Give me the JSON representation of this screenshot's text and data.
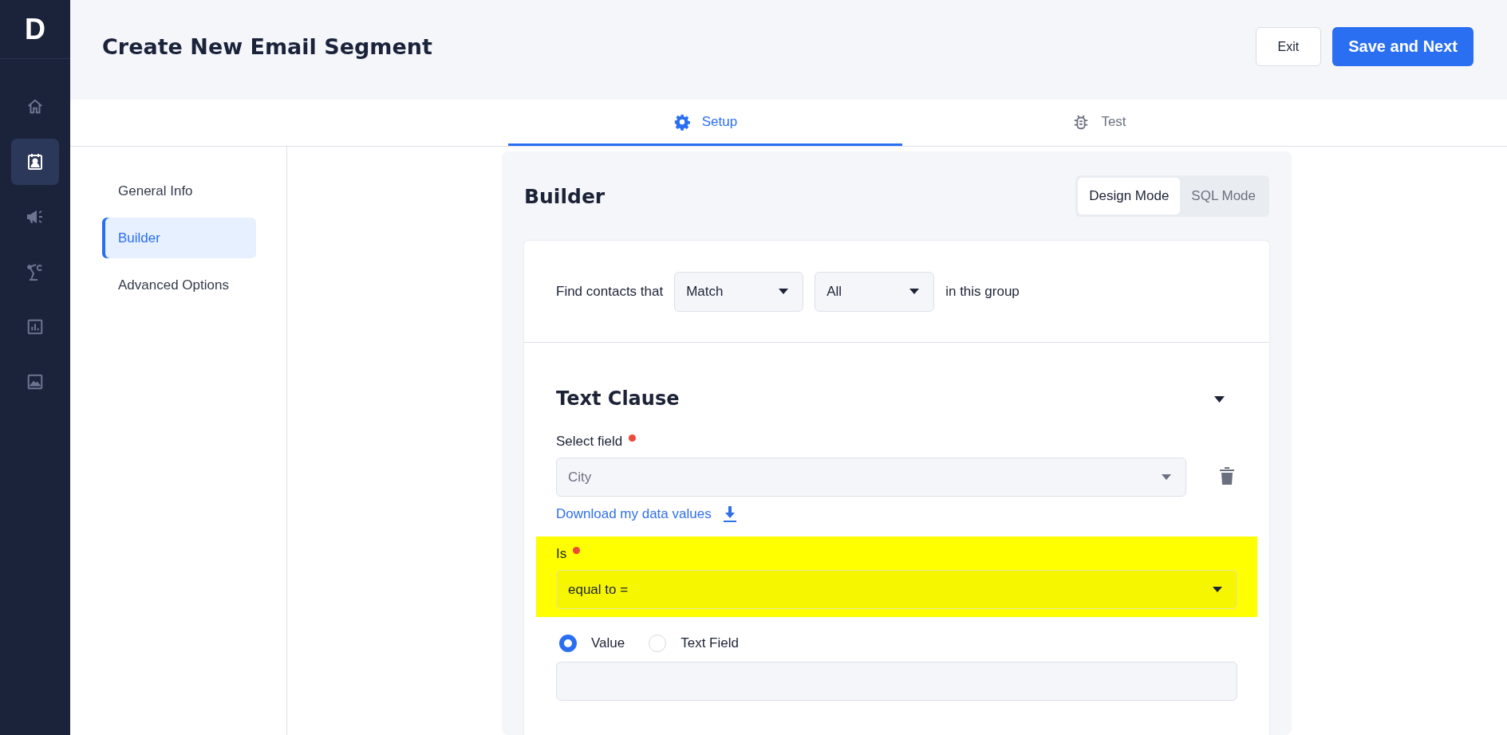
{
  "logo": "D",
  "rail": [
    {
      "kind": "home",
      "selected": false
    },
    {
      "kind": "contacts",
      "selected": true
    },
    {
      "kind": "campaigns",
      "selected": false
    },
    {
      "kind": "automation",
      "selected": false
    },
    {
      "kind": "reports",
      "selected": false
    },
    {
      "kind": "media",
      "selected": false
    }
  ],
  "header": {
    "title": "Create New Email Segment",
    "buttons": [
      {
        "label": "Exit",
        "kind": "secondary"
      },
      {
        "label": "Save and Next",
        "kind": "primary"
      }
    ]
  },
  "tabs": [
    {
      "label": "Setup",
      "kind": "setup",
      "selected": true
    },
    {
      "label": "Test",
      "kind": "test",
      "selected": false
    }
  ],
  "steps": [
    {
      "label": "General Info",
      "selected": false
    },
    {
      "label": "Builder",
      "selected": true
    },
    {
      "label": "Advanced Options",
      "selected": false
    }
  ],
  "builder": {
    "title": "Builder",
    "modes": [
      {
        "label": "Design Mode",
        "selected": true
      },
      {
        "label": "SQL Mode",
        "selected": false
      }
    ],
    "match_row": {
      "prefix": "Find contacts that",
      "match": "Match",
      "scope": "All",
      "suffix": "in this group"
    },
    "clause": {
      "title": "Text Clause",
      "expanded": true,
      "field": {
        "label": "Select field",
        "required": true,
        "value": "City"
      },
      "download_link": "Download my data values",
      "operator": {
        "label": "Is",
        "required": true,
        "value": "equal to =",
        "highlighted": true
      },
      "value_types": [
        {
          "label": "Value",
          "selected": true
        },
        {
          "label": "Text Field",
          "selected": false
        }
      ]
    }
  }
}
